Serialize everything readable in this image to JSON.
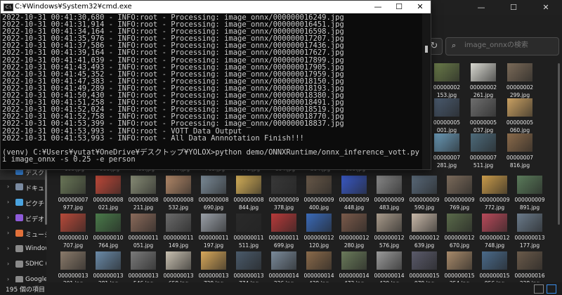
{
  "cmd": {
    "title": "C:¥Windows¥System32¥cmd.exe",
    "icon_label": "C:\\",
    "minimize": "—",
    "maximize": "☐",
    "close": "✕",
    "lines": [
      "2022-10-31 00:41:30,680 - INFO:root - Processing: image_onnx/000000016249.jpg",
      "2022-10-31 00:41:31,914 - INFO:root - Processing: image_onnx/000000016451.jpg",
      "2022-10-31 00:41:34,164 - INFO:root - Processing: image_onnx/000000016598.jpg",
      "2022-10-31 00:41:35,976 - INFO:root - Processing: image_onnx/000000017207.jpg",
      "2022-10-31 00:41:37,586 - INFO:root - Processing: image_onnx/000000017436.jpg",
      "2022-10-31 00:41:39,164 - INFO:root - Processing: image_onnx/000000017627.jpg",
      "2022-10-31 00:41:41,039 - INFO:root - Processing: image_onnx/000000017899.jpg",
      "2022-10-31 00:41:43,493 - INFO:root - Processing: image_onnx/000000017905.jpg",
      "2022-10-31 00:41:45,352 - INFO:root - Processing: image_onnx/000000017959.jpg",
      "2022-10-31 00:41:47,383 - INFO:root - Processing: image_onnx/000000018150.jpg",
      "2022-10-31 00:41:49,289 - INFO:root - Processing: image_onnx/000000018193.jpg",
      "2022-10-31 00:41:50,430 - INFO:root - Processing: image_onnx/000000018380.jpg",
      "2022-10-31 00:41:51,258 - INFO:root - Processing: image_onnx/000000018491.jpg",
      "2022-10-31 00:41:52,024 - INFO:root - Processing: image_onnx/000000018519.jpg",
      "2022-10-31 00:41:52,758 - INFO:root - Processing: image_onnx/000000018770.jpg",
      "2022-10-31 00:41:53,399 - INFO:root - Processing: image_onnx/000000018837.jpg",
      "2022-10-31 00:41:53,993 - INFO:root - VOTT Data Output",
      "2022-10-31 00:41:53,993 - INFO:root - All Data Annnotation Finish!!!",
      "",
      "(venv) C:¥Users¥yutat¥OneDrive¥デスクトップ¥YOLOX>python demo/ONNXRuntime/onnx_inference_vott.py -m model/yolox_s.onnx -",
      "i image_onnx -s 0.25 -e person"
    ]
  },
  "explorer": {
    "minimize": "—",
    "maximize": "☐",
    "close": "✕",
    "refresh": "↻",
    "search_placeholder": "image_onnxの検索",
    "status": "195 個の項目",
    "nav": [
      {
        "label": "デスクトップ",
        "color": "#3b8eea",
        "chevron": ""
      },
      {
        "label": "ドキュメント",
        "color": "#7a8aa0",
        "chevron": "›"
      },
      {
        "label": "ピクチャ",
        "color": "#4aa3df",
        "chevron": "›"
      },
      {
        "label": "ビデオ",
        "color": "#8e5bd9",
        "chevron": "›"
      },
      {
        "label": "ミュージック",
        "color": "#e0703a",
        "chevron": "›"
      },
      {
        "label": "Windows",
        "color": "#8a8a8a",
        "chevron": "›"
      },
      {
        "label": "SDHC (F",
        "color": "#8a8a8a",
        "chevron": "›"
      },
      {
        "label": "Google",
        "color": "#8a8a8a",
        "chevron": "›"
      }
    ],
    "right_rows": [
      {
        "items": [
          {
            "l1": "00000002",
            "l2": "153.jpg",
            "color": "#6b7c4a"
          },
          {
            "l1": "00000002",
            "l2": "261.jpg",
            "color": "#d8d8d0"
          },
          {
            "l1": "00000002",
            "l2": "299.jpg",
            "color": "#7a6a58"
          }
        ]
      },
      {
        "items": [
          {
            "l1": "00000005",
            "l2": "001.jpg",
            "color": "#4a5a6e"
          },
          {
            "l1": "00000005",
            "l2": "037.jpg",
            "color": "#6e6e6e"
          },
          {
            "l1": "00000005",
            "l2": "060.jpg",
            "color": "#c9a062"
          }
        ]
      },
      {
        "items": [
          {
            "l1": "00000007",
            "l2": "281.jpg",
            "color": "#6a9ab8"
          },
          {
            "l1": "00000007",
            "l2": "511.jpg",
            "color": "#4d6a7a"
          },
          {
            "l1": "00000007",
            "l2": "816.jpg",
            "color": "#8a6a4a"
          }
        ]
      }
    ],
    "partial_row": [
      "193.jpg",
      "586.jpg",
      "460.jpg",
      "477.jpg",
      "763.jpg",
      "771.jpg",
      "894.jpg",
      "394.jpg",
      "088.jpg"
    ],
    "grid": [
      [
        {
          "l1": "000000007",
          "l2": "977.jpg",
          "color": "#6d7a5a"
        },
        {
          "l1": "000000008",
          "l2": "021.jpg",
          "color": "#c24a3a"
        },
        {
          "l1": "000000008",
          "l2": "211.jpg",
          "color": "#8a8f78"
        },
        {
          "l1": "000000008",
          "l2": "532.jpg",
          "color": "#b58a6a"
        },
        {
          "l1": "000000008",
          "l2": "690.jpg",
          "color": "#7d8d9a"
        },
        {
          "l1": "000000008",
          "l2": "844.jpg",
          "color": "#d8b25a"
        },
        {
          "l1": "000000009",
          "l2": "378.jpg",
          "color": "#3a3a3a"
        },
        {
          "l1": "000000009",
          "l2": "400.jpg",
          "color": "#6a5a4a"
        },
        {
          "l1": "000000009",
          "l2": "448.jpg",
          "color": "#3a5ac8"
        },
        {
          "l1": "000000009",
          "l2": "483.jpg",
          "color": "#8a8a8a"
        },
        {
          "l1": "000000009",
          "l2": "590.jpg",
          "color": "#5a6a7a"
        },
        {
          "l1": "000000009",
          "l2": "769.jpg",
          "color": "#7a6a5a"
        },
        {
          "l1": "000000009",
          "l2": "772.jpg",
          "color": "#c89a4a"
        },
        {
          "l1": "000000009",
          "l2": "891.jpg",
          "color": "#5a7a5a"
        }
      ],
      [
        {
          "l1": "000000010",
          "l2": "707.jpg",
          "color": "#b84a3a"
        },
        {
          "l1": "000000010",
          "l2": "764.jpg",
          "color": "#4a7a4a"
        },
        {
          "l1": "000000011",
          "l2": "051.jpg",
          "color": "#8a6a5a"
        },
        {
          "l1": "000000011",
          "l2": "149.jpg",
          "color": "#6a6a6a"
        },
        {
          "l1": "000000011",
          "l2": "197.jpg",
          "color": "#9aa0a8"
        },
        {
          "l1": "000000011",
          "l2": "511.jpg",
          "color": "#2a2a2a"
        },
        {
          "l1": "000000011",
          "l2": "699.jpg",
          "color": "#b83a3a"
        },
        {
          "l1": "000000012",
          "l2": "120.jpg",
          "color": "#3a6ab8"
        },
        {
          "l1": "000000012",
          "l2": "280.jpg",
          "color": "#7a5a4a"
        },
        {
          "l1": "000000012",
          "l2": "576.jpg",
          "color": "#a89a8a"
        },
        {
          "l1": "000000012",
          "l2": "639.jpg",
          "color": "#c8b8a8"
        },
        {
          "l1": "000000012",
          "l2": "670.jpg",
          "color": "#5a6a4a"
        },
        {
          "l1": "000000012",
          "l2": "748.jpg",
          "color": "#b84a5a"
        },
        {
          "l1": "000000013",
          "l2": "177.jpg",
          "color": "#6a7a8a"
        }
      ],
      [
        {
          "l1": "000000013",
          "l2": "201.jpg",
          "color": "#8a7a6a"
        },
        {
          "l1": "000000013",
          "l2": "281.jpg",
          "color": "#6a8aa8"
        },
        {
          "l1": "000000013",
          "l2": "546.jpg",
          "color": "#7a7a7a"
        },
        {
          "l1": "000000013",
          "l2": "659.jpg",
          "color": "#c8c0b0"
        },
        {
          "l1": "000000013",
          "l2": "729.jpg",
          "color": "#d8a85a"
        },
        {
          "l1": "000000013",
          "l2": "774.jpg",
          "color": "#4a5a6a"
        },
        {
          "l1": "000000014",
          "l2": "226.jpg",
          "color": "#7a8a9a"
        },
        {
          "l1": "000000014",
          "l2": "439.jpg",
          "color": "#8a6a4a"
        },
        {
          "l1": "000000014",
          "l2": "473.jpg",
          "color": "#6a7a5a"
        },
        {
          "l1": "000000014",
          "l2": "439.jpg",
          "color": "#9a9a9a"
        },
        {
          "l1": "000000015",
          "l2": "079.jpg",
          "color": "#5a5a6a"
        },
        {
          "l1": "000000015",
          "l2": "254.jpg",
          "color": "#a88a6a"
        },
        {
          "l1": "000000015",
          "l2": "956.jpg",
          "color": "#4a6a8a"
        },
        {
          "l1": "000000016",
          "l2": "228.jpg",
          "color": "#6a5a4a"
        }
      ]
    ]
  }
}
